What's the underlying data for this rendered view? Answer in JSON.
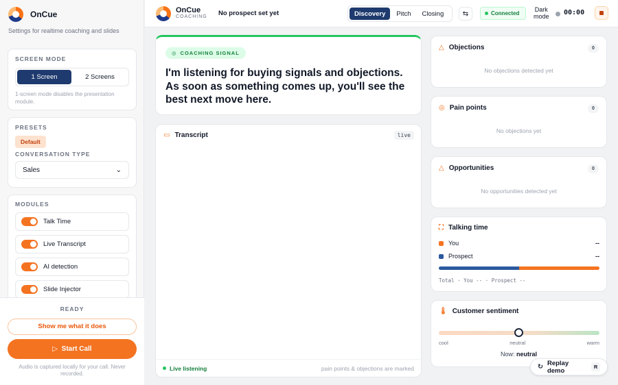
{
  "brand": {
    "name": "OnCue",
    "subtitle": "Settings for realtime coaching and slides",
    "header_sub": "COACHING"
  },
  "sidebar": {
    "screen_mode": {
      "title": "SCREEN MODE",
      "options": [
        "1 Screen",
        "2 Screens"
      ],
      "selected": "1 Screen",
      "note": "1-screen mode disables the presentation module."
    },
    "presets": {
      "title": "PRESETS",
      "chip": "Default",
      "conv_label": "CONVERSATION TYPE",
      "conv_value": "Sales"
    },
    "modules": {
      "title": "MODULES",
      "items": [
        "Talk Time",
        "Live Transcript",
        "AI detection",
        "Slide Injector"
      ]
    },
    "status": "READY",
    "demo_button": "Show me what it does",
    "start_button": "Start Call",
    "footnote": "Audio is captured locally for your call. Never recorded."
  },
  "header": {
    "prospect": "No prospect set yet",
    "tabs": [
      "Discovery",
      "Pitch",
      "Closing"
    ],
    "active_tab": "Discovery",
    "connection": "Connected",
    "dark_mode": [
      "Dark",
      "mode"
    ],
    "timer": "00:00"
  },
  "signal": {
    "chip": "COACHING SIGNAL",
    "text": "I'm listening for buying signals and objections. As soon as something comes up, you'll see the best next move here."
  },
  "transcript": {
    "title": "Transcript",
    "badge": "live",
    "status": "Live listening",
    "hint": "pain points & objections are marked"
  },
  "objections": {
    "title": "Objections",
    "count": "0",
    "empty": "No objections detected yet"
  },
  "pain_points": {
    "title": "Pain points",
    "count": "0",
    "empty": "No objections yet"
  },
  "opportunities": {
    "title": "Opportunities",
    "count": "0",
    "empty": "No opportunities detected yet"
  },
  "talking_time": {
    "title": "Talking time",
    "you_label": "You",
    "you_value": "--",
    "prospect_label": "Prospect",
    "prospect_value": "--",
    "total": "Total · You -- · Prospect --"
  },
  "sentiment": {
    "title": "Customer sentiment",
    "labels": [
      "cool",
      "neutral",
      "warm"
    ],
    "now_label": "Now:",
    "now_value": "neutral",
    "level": 0.5
  },
  "replay": {
    "label": "Replay demo",
    "key": "R"
  },
  "colors": {
    "accent": "#f47321",
    "navy": "#1e3a6e",
    "green": "#22c55e"
  }
}
